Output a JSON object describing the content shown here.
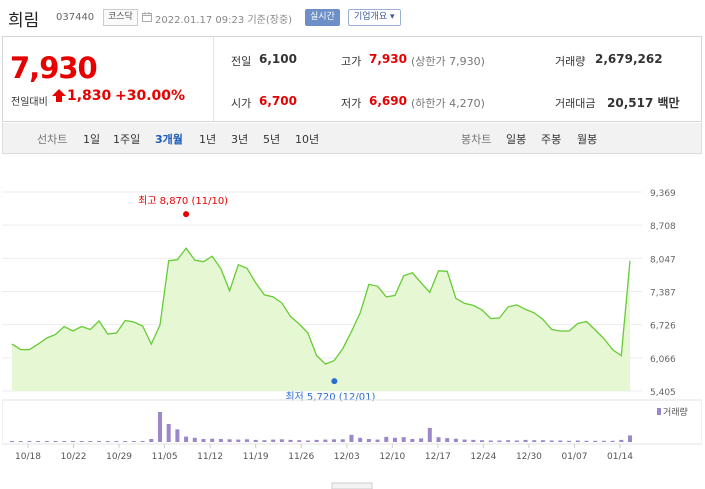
{
  "header": {
    "stock_name": "희림",
    "stock_code": "037440",
    "market": "코스닥",
    "datetime": "2022.01.17 09:23",
    "basis": "기준(장중)",
    "realtime_label": "실시간",
    "company_button": "기업개요"
  },
  "summary": {
    "price": "7,930",
    "change_label": "전일대비",
    "change_amount": "1,830",
    "change_percent": "+30.00%",
    "fields": {
      "prev_close_label": "전일",
      "prev_close": "6,100",
      "high_label": "고가",
      "high": "7,930",
      "upper_limit": "(상한가 7,930)",
      "volume_label": "거래량",
      "volume": "2,679,262",
      "open_label": "시가",
      "open": "6,700",
      "low_label": "저가",
      "low": "6,690",
      "lower_limit": "(하한가 4,270)",
      "amount_label": "거래대금",
      "amount": "20,517 백만"
    }
  },
  "tabs": {
    "line_label": "선차트",
    "periods": [
      "1일",
      "1주일",
      "3개월",
      "1년",
      "3년",
      "5년",
      "10년"
    ],
    "active_period": "3개월",
    "candle_label": "봉차트",
    "candle_periods": [
      "일봉",
      "주봉",
      "월봉"
    ]
  },
  "colors": {
    "up_red": "#e60000",
    "line_green": "#66cc33",
    "fill_green": "#e6f7d4",
    "volume_purple": "#9b87c9",
    "low_blue": "#2b6ed3",
    "active_tab_blue": "#1a5bb9"
  },
  "chart_data": {
    "type": "area",
    "y_ticks": [
      "9,369",
      "8,708",
      "8,047",
      "7,387",
      "6,726",
      "6,066",
      "5,405"
    ],
    "ylim": [
      5405,
      9369
    ],
    "x_ticks": [
      "10/18",
      "10/22",
      "10/29",
      "11/05",
      "11/12",
      "11/19",
      "11/26",
      "12/03",
      "12/10",
      "12/17",
      "12/24",
      "12/30",
      "01/07",
      "01/14"
    ],
    "high_annotation": "최고 8,870 (11/10)",
    "low_annotation": "최저 5,720 (12/01)",
    "volume_legend": "거래량",
    "price_series": [
      6340,
      6230,
      6230,
      6340,
      6460,
      6530,
      6690,
      6600,
      6690,
      6630,
      6800,
      6540,
      6560,
      6810,
      6780,
      6700,
      6340,
      6720,
      8000,
      8020,
      8250,
      8010,
      7980,
      8090,
      7840,
      7400,
      7920,
      7850,
      7560,
      7320,
      7280,
      7160,
      6890,
      6740,
      6560,
      6110,
      5940,
      6010,
      6250,
      6590,
      6960,
      7530,
      7490,
      7280,
      7310,
      7700,
      7760,
      7560,
      7370,
      7800,
      7790,
      7250,
      7150,
      7110,
      7020,
      6850,
      6860,
      7080,
      7120,
      7030,
      6960,
      6830,
      6630,
      6600,
      6600,
      6750,
      6790,
      6620,
      6450,
      6230,
      6110,
      8000
    ],
    "volume_series": [
      0.02,
      0.01,
      0.01,
      0.02,
      0.01,
      0.01,
      0.01,
      0.01,
      0.02,
      0.01,
      0.01,
      0.01,
      0.01,
      0.02,
      0.01,
      0.01,
      0.1,
      1.0,
      0.6,
      0.42,
      0.18,
      0.14,
      0.1,
      0.11,
      0.1,
      0.09,
      0.08,
      0.09,
      0.07,
      0.06,
      0.08,
      0.09,
      0.07,
      0.06,
      0.05,
      0.07,
      0.08,
      0.09,
      0.09,
      0.24,
      0.14,
      0.1,
      0.08,
      0.17,
      0.14,
      0.16,
      0.1,
      0.12,
      0.47,
      0.16,
      0.13,
      0.11,
      0.08,
      0.07,
      0.06,
      0.05,
      0.05,
      0.06,
      0.05,
      0.07,
      0.06,
      0.06,
      0.05,
      0.05,
      0.04,
      0.05,
      0.04,
      0.04,
      0.04,
      0.04,
      0.07,
      0.22
    ]
  }
}
